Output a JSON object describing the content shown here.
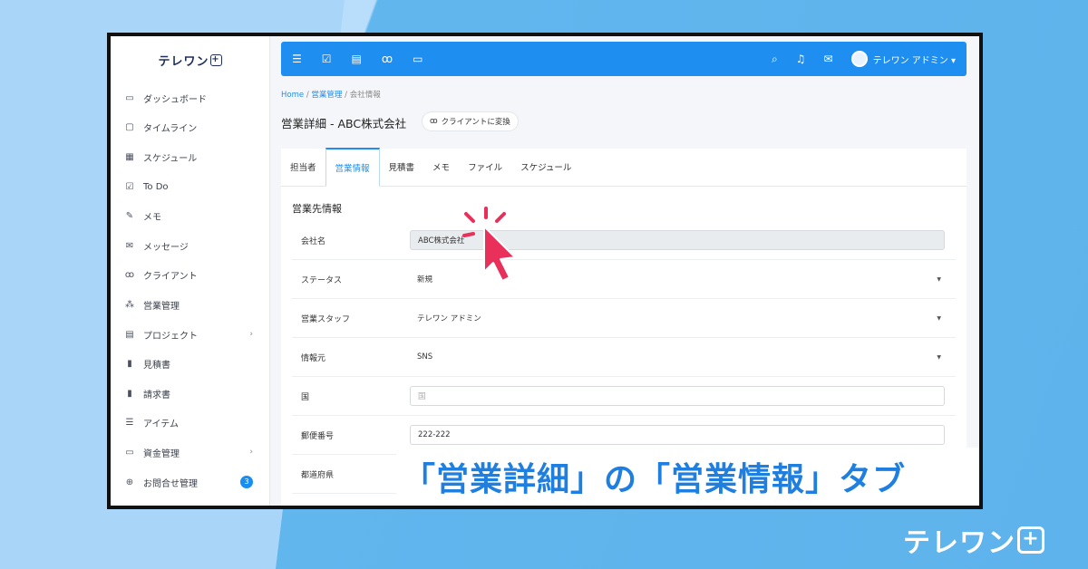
{
  "app": {
    "logo_text": "テレワン",
    "logo_plus": "+"
  },
  "sidebar": {
    "items": [
      {
        "label": "ダッシュボード",
        "icon": "monitor-icon"
      },
      {
        "label": "タイムライン",
        "icon": "square-icon"
      },
      {
        "label": "スケジュール",
        "icon": "calendar-icon"
      },
      {
        "label": "To Do",
        "icon": "check-square-icon"
      },
      {
        "label": "メモ",
        "icon": "edit-icon"
      },
      {
        "label": "メッセージ",
        "icon": "envelope-icon"
      },
      {
        "label": "クライアント",
        "icon": "users-icon"
      },
      {
        "label": "営業管理",
        "icon": "network-icon"
      },
      {
        "label": "プロジェクト",
        "icon": "briefcase-icon"
      },
      {
        "label": "見積書",
        "icon": "file-icon"
      },
      {
        "label": "請求書",
        "icon": "file-text-icon"
      },
      {
        "label": "アイテム",
        "icon": "list-icon"
      },
      {
        "label": "資金管理",
        "icon": "money-icon"
      },
      {
        "label": "お問合せ管理",
        "icon": "lifebuoy-icon"
      }
    ],
    "inquiry_badge": "3"
  },
  "topbar": {
    "user_name": "テレワン アドミン"
  },
  "breadcrumb": {
    "home": "Home",
    "sales": "営業管理",
    "current": "会社情報"
  },
  "page": {
    "title": "営業詳細 - ABC株式会社",
    "convert_button": "クライアントに変換"
  },
  "tabs": [
    {
      "label": "担当者"
    },
    {
      "label": "営業情報"
    },
    {
      "label": "見積書"
    },
    {
      "label": "メモ"
    },
    {
      "label": "ファイル"
    },
    {
      "label": "スケジュール"
    }
  ],
  "form": {
    "section_title": "営業先情報",
    "rows": [
      {
        "label": "会社名",
        "value": "ABC株式会社"
      },
      {
        "label": "ステータス",
        "value": "新規"
      },
      {
        "label": "営業スタッフ",
        "value": "テレワン アドミン"
      },
      {
        "label": "情報元",
        "value": "SNS"
      },
      {
        "label": "国",
        "value": "国"
      },
      {
        "label": "郵便番号",
        "value": "222-222"
      },
      {
        "label": "都道府県",
        "value": ""
      }
    ]
  },
  "caption": "「営業詳細」の「営業情報」タブ",
  "brand": {
    "text": "テレワン",
    "plus": "+"
  },
  "colors": {
    "accent": "#1f8ef1",
    "caption": "#1e7fe0",
    "cursor": "#e8305a"
  }
}
